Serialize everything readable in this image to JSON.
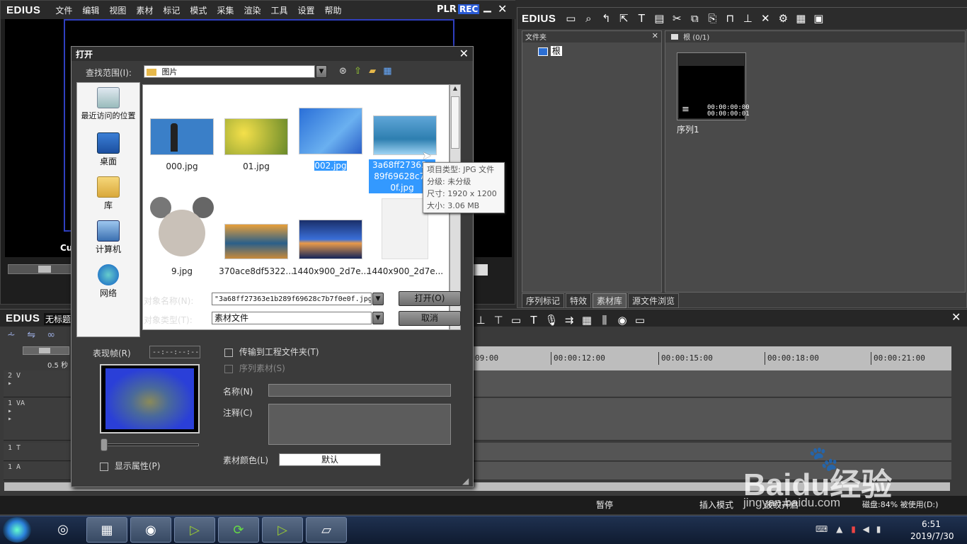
{
  "app": {
    "logo": "EDIUS",
    "menu": [
      "文件",
      "编辑",
      "视图",
      "素材",
      "标记",
      "模式",
      "采集",
      "渲染",
      "工具",
      "设置",
      "帮助"
    ],
    "plr": "PLR",
    "rec": "REC",
    "preview_text": "Cu"
  },
  "bin": {
    "logo": "EDIUS",
    "folder_header": "文件夹",
    "root_label": "根",
    "content_header": "根 (0/1)",
    "clip_time1": "00:00:00:00",
    "clip_time2": "00:00:00:01",
    "clip_name": "序列1",
    "tabs": [
      "序列标记",
      "特效",
      "素材库",
      "源文件浏览"
    ]
  },
  "timeline": {
    "logo": "EDIUS",
    "title": "无标题",
    "zoom": "0.5 秒",
    "tracks": [
      "2 V",
      "1 VA",
      "1 T",
      "1 A"
    ],
    "ticks": [
      "09:00",
      "00:00:12:00",
      "00:00:15:00",
      "00:00:18:00",
      "00:00:21:00"
    ]
  },
  "dialog": {
    "title": "打开",
    "lookin_label": "查找范围(I):",
    "lookin_value": "图片",
    "places": [
      "最近访问的位置",
      "桌面",
      "库",
      "计算机",
      "网络"
    ],
    "files": [
      {
        "name": "000.jpg",
        "color": "#3a7fc8"
      },
      {
        "name": "01.jpg",
        "color": "#c9b43a"
      },
      {
        "name": "002.jpg",
        "color": "#2a6fd8"
      },
      {
        "name": "3a68ff27363e1b289f69628c7b7f0e0f.jpg",
        "color": "#3d8ab8"
      },
      {
        "name": "9.jpg",
        "color": "#cfc6bd"
      },
      {
        "name": "370ace8df5322...",
        "color": "#d88b2e"
      },
      {
        "name": "1440x900_2d7e...",
        "color": "#2b4f9e"
      },
      {
        "name": "1440x900_2d7e...",
        "color": "#f2f2f2"
      }
    ],
    "selected_caption_lines": [
      "3a68ff27363e",
      "89f69628c7b",
      "0f.jpg"
    ],
    "tooltip": [
      "项目类型: JPG 文件",
      "分级: 未分级",
      "尺寸: 1920 x 1200",
      "大小: 3.06 MB"
    ],
    "filename_label": "对象名称(N):",
    "filename_value": "\"3a68ff27363e1b289f69628c7b7f0e0f.jpg\"",
    "filetype_label": "对象类型(T):",
    "filetype_value": "素材文件",
    "open_button": "打开(O)",
    "cancel_button": "取消",
    "frame_label": "表现帧(R)",
    "frame_value": "--:--:--:--",
    "transfer_label": "传输到工程文件夹(T)",
    "sequence_label": "序列素材(S)",
    "name_label": "名称(N)",
    "comment_label": "注释(C)",
    "color_label": "素材颜色(L)",
    "color_value": "默认",
    "show_props_label": "显示属性(P)"
  },
  "statusbar": {
    "pause": "暂停",
    "insert": "插入模式",
    "ripple": "波纹开启",
    "disk": "磁盘:84% 被使用(D:)"
  },
  "watermark": {
    "logo": "Baidu经验",
    "url": "jingyan.baidu.com"
  },
  "taskbar": {
    "time": "6:51",
    "date": "2019/7/30"
  }
}
